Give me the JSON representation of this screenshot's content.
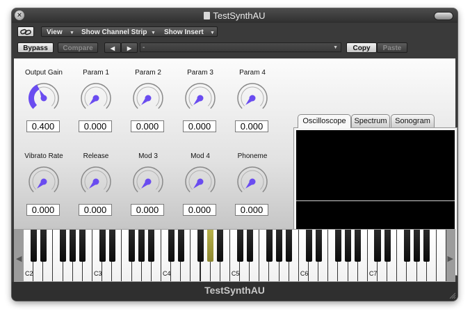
{
  "window": {
    "title": "TestSynthAU"
  },
  "toolbar": {
    "link_icon": "link-icon",
    "view_label": "View",
    "show_channel_strip_label": "Show Channel Strip",
    "show_insert_label": "Show Insert",
    "bypass_label": "Bypass",
    "compare_label": "Compare",
    "prev_icon": "arrow-left-icon",
    "next_icon": "arrow-right-icon",
    "preset_value": "-",
    "copy_label": "Copy",
    "paste_label": "Paste"
  },
  "knobs_row1": [
    {
      "label": "Output Gain",
      "value": "0.400",
      "level": 0.4
    },
    {
      "label": "Param 1",
      "value": "0.000",
      "level": 0.0
    },
    {
      "label": "Param 2",
      "value": "0.000",
      "level": 0.0
    },
    {
      "label": "Param 3",
      "value": "0.000",
      "level": 0.0
    },
    {
      "label": "Param 4",
      "value": "0.000",
      "level": 0.0
    }
  ],
  "knobs_row2": [
    {
      "label": "Vibrato Rate",
      "value": "0.000",
      "level": 0.0
    },
    {
      "label": "Release",
      "value": "0.000",
      "level": 0.0
    },
    {
      "label": "Mod 3",
      "value": "0.000",
      "level": 0.0
    },
    {
      "label": "Mod 4",
      "value": "0.000",
      "level": 0.0
    },
    {
      "label": "Phoneme",
      "value": "0.000",
      "level": 0.0
    }
  ],
  "display_tabs": [
    "Oscilloscope",
    "Spectrum",
    "Sonogram"
  ],
  "active_tab": "Oscilloscope",
  "keyboard": {
    "octave_labels": [
      "C2",
      "C3",
      "C4",
      "C5",
      "C6",
      "C7"
    ],
    "pressed_key": "G#4"
  },
  "footer": {
    "title": "TestSynthAU"
  },
  "colors": {
    "knob_accent": "#6a4cf0",
    "pressed_key": "#a09a3a",
    "chrome": "#3a3a3a",
    "scope_bg": "#000000"
  }
}
